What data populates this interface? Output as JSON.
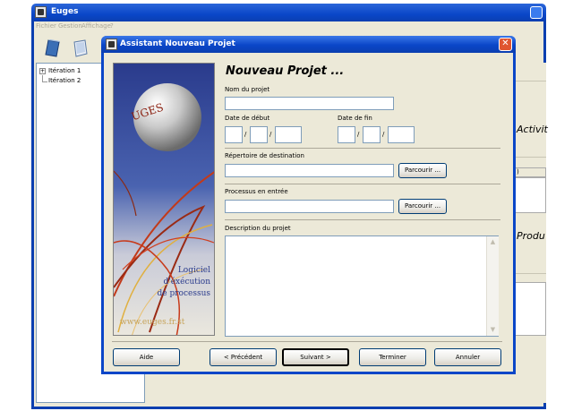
{
  "app": {
    "title": "Euges",
    "menu": [
      "Fichier",
      "Gestion",
      "Affichage",
      "?"
    ]
  },
  "tree": {
    "items": [
      {
        "label": "Itération 1",
        "expander": "+"
      },
      {
        "label": "Itération 2"
      }
    ]
  },
  "right_panel": {
    "section1": "Activit",
    "section2": "Produ",
    "tag": ")"
  },
  "dialog": {
    "title": "Assistant Nouveau Projet",
    "close_label": "✕",
    "heading": "Nouveau Projet ...",
    "project_name": {
      "label": "Nom du projet",
      "value": ""
    },
    "start_date": {
      "label": "Date de début",
      "separator": "/"
    },
    "end_date": {
      "label": "Date de fin",
      "separator": "/"
    },
    "destination": {
      "label": "Répertoire de destination",
      "value": "",
      "browse": "Parcourir ..."
    },
    "process": {
      "label": "Processus en entrée",
      "value": "",
      "browse": "Parcourir ..."
    },
    "description": {
      "label": "Description du projet",
      "value": ""
    },
    "buttons": {
      "help": "Aide",
      "previous": "< Précédent",
      "next": "Suivant >",
      "finish": "Terminer",
      "cancel": "Annuler"
    }
  },
  "banner": {
    "ball_text": "UGES",
    "line1": "Logiciel",
    "line2": "d'éxécution",
    "line3": "de processus",
    "url": "www.euges.fr.st"
  },
  "colors": {
    "titlebar": "#0a46c8",
    "dialog_bg": "#ece9d8",
    "field_border": "#7f9db9"
  }
}
